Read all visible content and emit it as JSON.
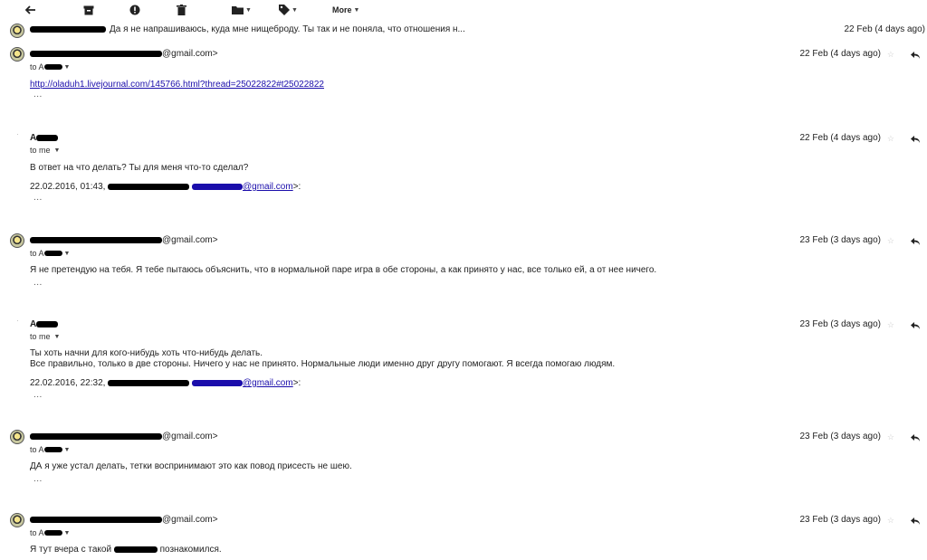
{
  "toolbar": {
    "back_icon": "back-arrow-icon",
    "archive_icon": "archive-icon",
    "spam_icon": "report-spam-icon",
    "delete_icon": "trash-icon",
    "folder_icon": "folder-icon",
    "labels_icon": "label-tag-icon",
    "more_label": "More"
  },
  "collapsed": {
    "snippet": "Да я не напрашиваюсь, куда мне нищеброду. Ты так и не поняла, что отношения н...",
    "date": "22 Feb (4 days ago)"
  },
  "messages": [
    {
      "sender_suffix": "@gmail.com>",
      "to_label": "to A",
      "date": "22 Feb (4 days ago)",
      "link": "http://oladuh1.livejournal.com/145766.html?thread=25022822#t25022822",
      "dots": "..."
    },
    {
      "sender": "A",
      "to_label": "to me",
      "date": "22 Feb (4 days ago)",
      "body": "В ответ на что делать? Ты для меня что-то сделал?",
      "quote_prefix": "22.02.2016, 01:43,",
      "quote_email": "@gmail.com",
      "quote_suffix": ">:",
      "dots": "..."
    },
    {
      "sender_suffix": "@gmail.com>",
      "to_label": "to A",
      "date": "23 Feb (3 days ago)",
      "body": "Я не претендую на тебя. Я тебе пытаюсь объяснить, что в нормальной паре игра в обе стороны, а как принято у нас, все только ей, а от нее ничего.",
      "dots": "..."
    },
    {
      "sender": "A",
      "to_label": "to me",
      "date": "23 Feb (3 days ago)",
      "body_line1": "Ты хоть начни для кого-нибудь хоть что-нибудь делать.",
      "body_line2": "Все правильно, только в две стороны. Ничего у нас не принято. Нормальные люди именно друг другу помогают. Я всегда помогаю людям.",
      "quote_prefix": "22.02.2016, 22:32,",
      "quote_email": "@gmail.com",
      "quote_suffix": ">:",
      "dots": "..."
    },
    {
      "sender_suffix": "@gmail.com>",
      "to_label": "to A",
      "date": "23 Feb (3 days ago)",
      "body": "ДА я уже устал делать, тетки воспринимают это как повод присесть не шею.",
      "dots": "..."
    },
    {
      "sender_suffix": "@gmail.com>",
      "to_label": "to A",
      "date": "23 Feb (3 days ago)",
      "body_prefix": "Я тут вчера с такой",
      "body_suffix": "познакомился."
    }
  ]
}
